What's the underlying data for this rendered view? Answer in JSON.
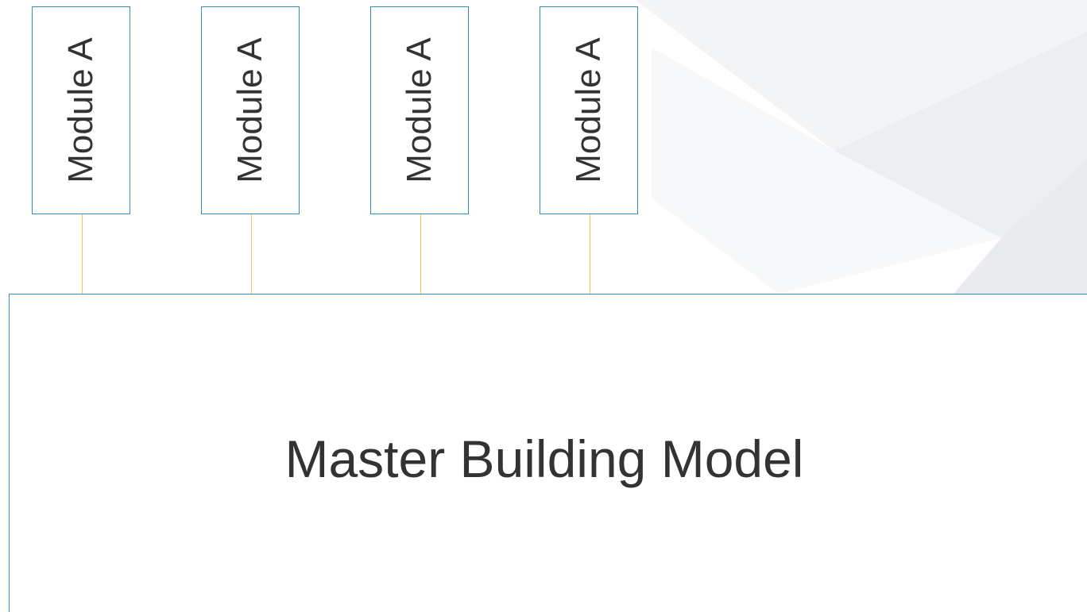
{
  "modules": [
    {
      "label": "Module A"
    },
    {
      "label": "Module A"
    },
    {
      "label": "Module A"
    },
    {
      "label": "Module A"
    }
  ],
  "master": {
    "label": "Master Building Model"
  },
  "colors": {
    "box_border": "#2f8fc9",
    "connector": "#f5c55a",
    "text": "#333333"
  }
}
